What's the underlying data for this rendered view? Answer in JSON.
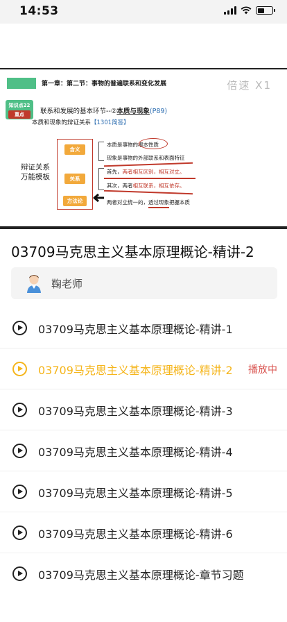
{
  "status_bar": {
    "time": "14:53",
    "battery_level": 0.45
  },
  "video": {
    "speed_label": "倍速 X1",
    "slide": {
      "chapter_title": "第一章：第二节：事物的普遍联系和变化发展",
      "kp_badge_top": "知识点22",
      "kp_badge_bottom": "重点",
      "heading_prefix": "联系和发展的基本环节--②",
      "heading_bold": "本质与现象",
      "heading_page": "(P89)",
      "sub_prefix": "本质和现象的辩证关系",
      "sub_ref": "【1301简答】",
      "side_label_line1": "辩证关系",
      "side_label_line2": "万能模板",
      "tag_meaning": "含义",
      "tag_relation": "关系",
      "tag_method": "方法论",
      "line_1": "本质是事物的根本性质",
      "line_2": "现象是事物的外部联系和表面特征",
      "line_3_prefix": "首先，",
      "line_3_red": "两者相互区别，相互对立。",
      "line_4_prefix": "其次，两者",
      "line_4_red": "相互联系，相互依存。",
      "line_5": "两者对立统一的，透过现象把握本质"
    }
  },
  "course_title": "03709马克思主义基本原理概论-精讲-2",
  "teacher": {
    "name": "鞠老师",
    "avatar_icon": "teacher-avatar-icon"
  },
  "lessons": [
    {
      "label": "03709马克思主义基本原理概论-精讲-1",
      "active": false
    },
    {
      "label": "03709马克思主义基本原理概论-精讲-2",
      "active": true,
      "status": "播放中"
    },
    {
      "label": "03709马克思主义基本原理概论-精讲-3",
      "active": false
    },
    {
      "label": "03709马克思主义基本原理概论-精讲-4",
      "active": false
    },
    {
      "label": "03709马克思主义基本原理概论-精讲-5",
      "active": false
    },
    {
      "label": "03709马克思主义基本原理概论-精讲-6",
      "active": false
    },
    {
      "label": "03709马克思主义基本原理概论-章节习题",
      "active": false
    }
  ],
  "colors": {
    "accent": "#f5b51b",
    "playing": "#d9534f",
    "green": "#4fbf87",
    "red": "#c0392b",
    "orange": "#f2a93b"
  }
}
